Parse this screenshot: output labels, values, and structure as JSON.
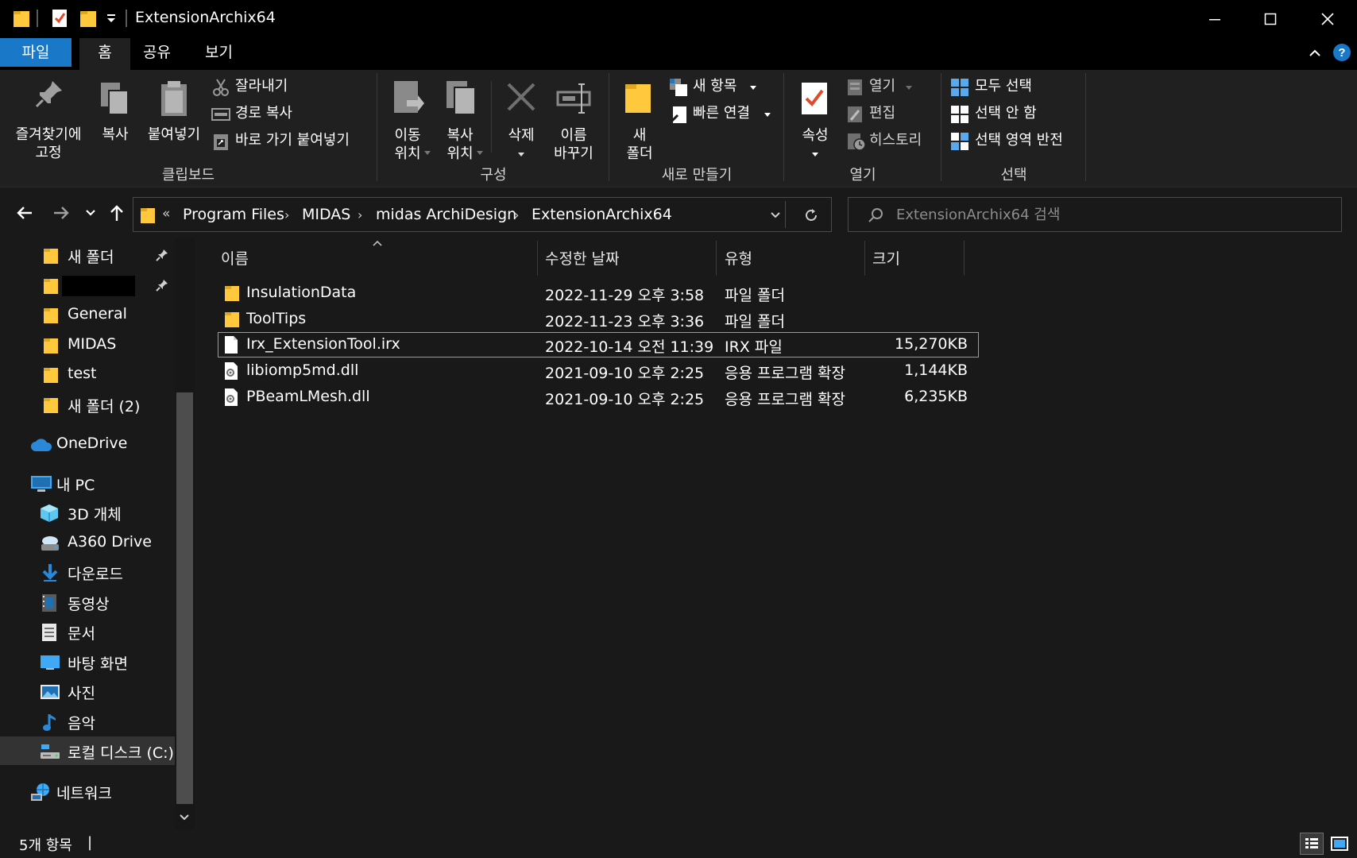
{
  "window": {
    "title": "ExtensionArchix64"
  },
  "ribbon_tabs": [
    {
      "label": "파일"
    },
    {
      "label": "홈"
    },
    {
      "label": "공유"
    },
    {
      "label": "보기"
    }
  ],
  "ribbon": {
    "clipboard": {
      "pin_label_1": "즐겨찾기에",
      "pin_label_2": "고정",
      "copy_label": "복사",
      "paste_label": "붙여넣기",
      "cut_label": "잘라내기",
      "copy_path_label": "경로 복사",
      "paste_shortcut_label": "바로 가기 붙여넣기",
      "group_label": "클립보드"
    },
    "organize": {
      "move_label_1": "이동",
      "move_label_2": "위치",
      "copyto_label_1": "복사",
      "copyto_label_2": "위치",
      "delete_label": "삭제",
      "rename_label_1": "이름",
      "rename_label_2": "바꾸기",
      "group_label": "구성"
    },
    "new": {
      "new_folder_label_1": "새",
      "new_folder_label_2": "폴더",
      "new_item_label": "새 항목",
      "easy_access_label": "빠른 연결",
      "group_label": "새로 만들기"
    },
    "open": {
      "properties_label": "속성",
      "open_label": "열기",
      "edit_label": "편집",
      "history_label": "히스토리",
      "group_label": "열기"
    },
    "select": {
      "select_all_label": "모두 선택",
      "select_none_label": "선택 안 함",
      "invert_label": "선택 영역 반전",
      "group_label": "선택"
    }
  },
  "address": {
    "overflow": "«",
    "crumbs": [
      "Program Files",
      "MIDAS",
      "midas ArchiDesign",
      "ExtensionArchix64"
    ],
    "search_placeholder": "ExtensionArchix64 검색"
  },
  "nav": {
    "items": [
      {
        "label": "새 폴더",
        "icon": "folder-icon"
      },
      {
        "label": "",
        "icon": "folder-icon"
      },
      {
        "label": "General",
        "icon": "folder-icon"
      },
      {
        "label": "MIDAS",
        "icon": "folder-icon"
      },
      {
        "label": "test",
        "icon": "folder-icon"
      },
      {
        "label": "새 폴더 (2)",
        "icon": "folder-icon"
      },
      {
        "label": "OneDrive",
        "icon": "cloud-icon"
      },
      {
        "label": "내 PC",
        "icon": "computer-icon"
      },
      {
        "label": "3D 개체",
        "icon": "cube-icon"
      },
      {
        "label": "A360 Drive",
        "icon": "drive-icon"
      },
      {
        "label": "다운로드",
        "icon": "download-icon"
      },
      {
        "label": "동영상",
        "icon": "video-icon"
      },
      {
        "label": "문서",
        "icon": "document-icon"
      },
      {
        "label": "바탕 화면",
        "icon": "desktop-icon"
      },
      {
        "label": "사진",
        "icon": "picture-icon"
      },
      {
        "label": "음악",
        "icon": "music-icon"
      },
      {
        "label": "로컬 디스크 (C:)",
        "icon": "disk-icon"
      },
      {
        "label": "네트워크",
        "icon": "network-icon"
      }
    ]
  },
  "list": {
    "columns": [
      "이름",
      "수정한 날짜",
      "유형",
      "크기"
    ],
    "rows": [
      {
        "name": "InsulationData",
        "date": "2022-11-29 오후 3:58",
        "type": "파일 폴더",
        "size": "",
        "icon": "folder-icon"
      },
      {
        "name": "ToolTips",
        "date": "2022-11-23 오후 3:36",
        "type": "파일 폴더",
        "size": "",
        "icon": "folder-icon"
      },
      {
        "name": "Irx_ExtensionTool.irx",
        "date": "2022-10-14 오전 11:39",
        "type": "IRX 파일",
        "size": "15,270KB",
        "icon": "file-icon"
      },
      {
        "name": "libiomp5md.dll",
        "date": "2021-09-10 오후 2:25",
        "type": "응용 프로그램 확장",
        "size": "1,144KB",
        "icon": "dll-icon"
      },
      {
        "name": "PBeamLMesh.dll",
        "date": "2021-09-10 오후 2:25",
        "type": "응용 프로그램 확장",
        "size": "6,235KB",
        "icon": "dll-icon"
      }
    ]
  },
  "status": {
    "count": "5개 항목",
    "cursor": "|"
  },
  "colors": {
    "accent": "#1a78c8",
    "background": "#191919",
    "folder": "#ffc83d"
  }
}
